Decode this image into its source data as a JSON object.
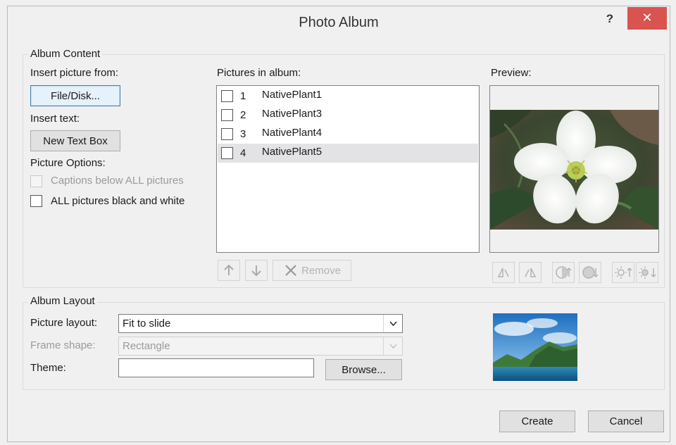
{
  "window": {
    "title": "Photo Album",
    "help_label": "?",
    "close_label": "✕"
  },
  "album_content": {
    "legend": "Album Content",
    "insert_picture_label": "Insert picture from:",
    "file_disk_button": "File/Disk...",
    "insert_text_label": "Insert text:",
    "new_text_box_button": "New Text Box",
    "picture_options_label": "Picture Options:",
    "captions_option": "Captions below ALL pictures",
    "black_white_option": "ALL pictures black and white",
    "pictures_label": "Pictures in album:",
    "pictures": [
      {
        "num": "1",
        "name": "NativePlant1"
      },
      {
        "num": "2",
        "name": "NativePlant3"
      },
      {
        "num": "3",
        "name": "NativePlant4"
      },
      {
        "num": "4",
        "name": "NativePlant5"
      }
    ],
    "selected_picture": "NativePlant5",
    "move_up_icon": "arrow-up-icon",
    "move_down_icon": "arrow-down-icon",
    "remove_button": "Remove",
    "preview_label": "Preview:",
    "preview_tools": [
      "rotate-left-icon",
      "rotate-right-icon",
      "contrast-up-icon",
      "contrast-down-icon",
      "brightness-up-icon",
      "brightness-down-icon"
    ]
  },
  "album_layout": {
    "legend": "Album Layout",
    "picture_layout_label": "Picture layout:",
    "picture_layout_value": "Fit to slide",
    "frame_shape_label": "Frame shape:",
    "frame_shape_value": "Rectangle",
    "theme_label": "Theme:",
    "theme_value": "",
    "browse_button": "Browse..."
  },
  "footer": {
    "create_button": "Create",
    "cancel_button": "Cancel"
  },
  "colors": {
    "close_button": "#d9534f",
    "selected_row": "#e3e3e5",
    "dialog_bg": "#f0f0f0"
  }
}
